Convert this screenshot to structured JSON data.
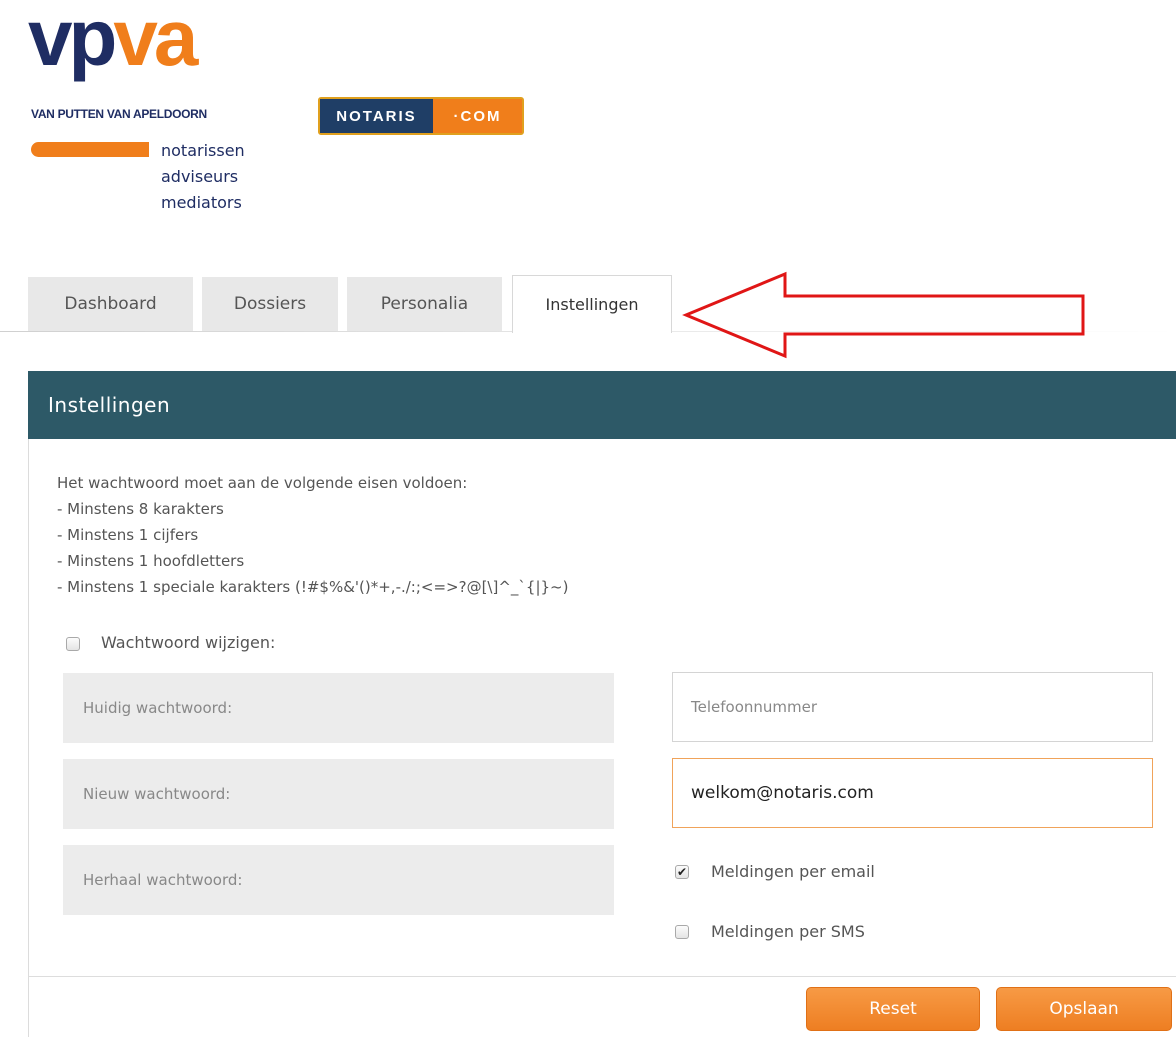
{
  "branding": {
    "logo_vp": "vp",
    "logo_va": "va",
    "subtitle": "VAN PUTTEN VAN APELDOORN",
    "lines": [
      "notarissen",
      "adviseurs",
      "mediators"
    ],
    "badge_left": "NOTARIS",
    "badge_right": "·COM",
    "colors": {
      "navy": "#1f2d63",
      "orange": "#f07e1b",
      "teal": "#2d5967"
    }
  },
  "tabs": [
    {
      "label": "Dashboard",
      "active": false
    },
    {
      "label": "Dossiers",
      "active": false
    },
    {
      "label": "Personalia",
      "active": false
    },
    {
      "label": "Instellingen",
      "active": true
    }
  ],
  "panel": {
    "title": "Instellingen",
    "requirements": [
      "Het wachtwoord moet aan de volgende eisen voldoen:",
      "- Minstens 8 karakters",
      "- Minstens 1 cijfers",
      "- Minstens 1 hoofdletters",
      "- Minstens 1 speciale karakters (!#$%&'()*+,-./:;<=>?@[\\]^_`{|}~)"
    ],
    "change_password": {
      "label": "Wachtwoord wijzigen:",
      "checked": false
    },
    "password_fields": {
      "current": "Huidig wachtwoord:",
      "new": "Nieuw wachtwoord:",
      "repeat": "Herhaal wachtwoord:"
    },
    "phone": {
      "placeholder": "Telefoonnummer",
      "value": ""
    },
    "email": {
      "value": "welkom@notaris.com"
    },
    "notify_email": {
      "label": "Meldingen per email",
      "checked": true
    },
    "notify_sms": {
      "label": "Meldingen per SMS",
      "checked": false
    }
  },
  "buttons": {
    "reset": "Reset",
    "save": "Opslaan"
  },
  "icons": {
    "checkmark": "✔",
    "annotation": "red-outline-arrow"
  }
}
